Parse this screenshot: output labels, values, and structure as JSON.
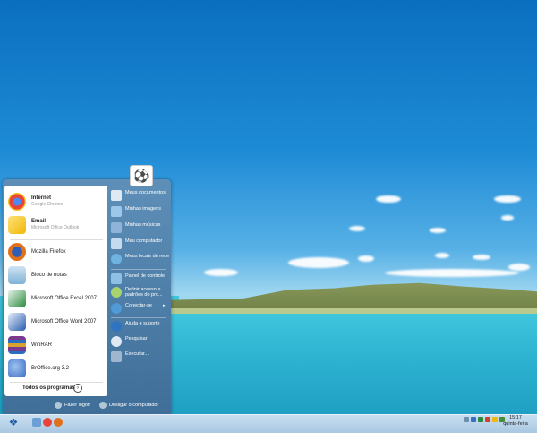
{
  "start_menu": {
    "pinned": [
      {
        "title": "Internet",
        "subtitle": "Google Chrome",
        "icon": "chrome-icon",
        "color": "#e8443a",
        "bold": true
      },
      {
        "title": "Email",
        "subtitle": "Microsoft Office Outlook",
        "icon": "outlook-icon",
        "color": "#f2b705",
        "bold": true
      }
    ],
    "recent": [
      {
        "title": "Mozilla Firefox",
        "icon": "firefox-icon",
        "color": "#e0701a"
      },
      {
        "title": "Bloco de notas",
        "icon": "notepad-icon",
        "color": "#7fb1d6"
      },
      {
        "title": "Microsoft Office Excel 2007",
        "icon": "excel-icon",
        "color": "#2b8a3e"
      },
      {
        "title": "Microsoft Office Word 2007",
        "icon": "word-icon",
        "color": "#2a5cad"
      },
      {
        "title": "WinRAR",
        "icon": "winrar-icon",
        "color": "#7a3b8f"
      },
      {
        "title": "BrOffice.org 3.2",
        "icon": "broffice-icon",
        "color": "#3a6ec4"
      }
    ],
    "all_programs": "Todos os programas",
    "right_items": [
      {
        "label": "Meus documentos",
        "icon": "documents-icon",
        "color": "#dfe9f3"
      },
      {
        "label": "Minhas imagens",
        "icon": "pictures-icon",
        "color": "#9cc7e8"
      },
      {
        "label": "Minhas músicas",
        "icon": "music-icon",
        "color": "#8fb3d9"
      },
      {
        "label": "Meu computador",
        "icon": "computer-icon",
        "color": "#c7dbee"
      },
      {
        "label": "Meus locais de rede",
        "icon": "network-icon",
        "color": "#6fb3e0"
      },
      {
        "label": "Painel de controle",
        "icon": "control-panel-icon",
        "color": "#8ec0e6"
      },
      {
        "label": "Definir acesso e padrões do pro...",
        "icon": "default-programs-icon",
        "color": "#a8d46f"
      },
      {
        "label": "Conectar-se",
        "icon": "connect-icon",
        "color": "#4f9ad8"
      },
      {
        "label": "Ajuda e suporte",
        "icon": "help-icon",
        "color": "#2f74c0"
      },
      {
        "label": "Pesquisar",
        "icon": "search-icon",
        "color": "#dfe9f3"
      },
      {
        "label": "Executar...",
        "icon": "run-icon",
        "color": "#9fb6cc"
      }
    ],
    "logoff": "Fazer logoff",
    "shutdown": "Desligar o computador"
  },
  "taskbar": {
    "time": "15:17",
    "day": "quinta-feira",
    "colors": {
      "start": "#1e5fa3"
    }
  }
}
